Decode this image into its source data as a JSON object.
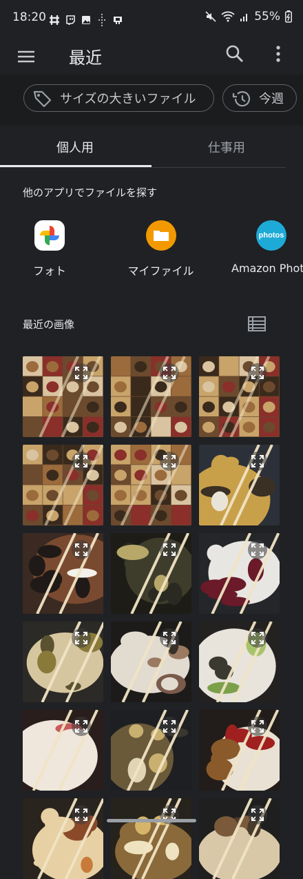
{
  "status_bar": {
    "time": "18:20",
    "battery": "55%"
  },
  "app_bar": {
    "title": "最近",
    "icons": [
      "menu-icon",
      "search-icon",
      "more-vert-icon"
    ]
  },
  "filters": {
    "large_files": "サイズの大きいファイル",
    "this_week": "今週"
  },
  "tabs": {
    "personal": "個人用",
    "work": "仕事用"
  },
  "sections": {
    "other_apps": "他のアプリでファイルを探す",
    "recent_images": "最近の画像"
  },
  "apps": [
    {
      "label": "フォト",
      "icon": "google-photos-icon"
    },
    {
      "label": "マイファイル",
      "icon": "my-files-icon"
    },
    {
      "label": "Amazon Photo",
      "icon": "amazon-photos-icon",
      "badge": "photos"
    }
  ],
  "colors": {
    "background": "#202124",
    "accent_orange": "#f29900",
    "amazon_blue": "#1eaad6"
  },
  "images": [
    "collage",
    "collage",
    "collage",
    "collage",
    "collage",
    "ramen",
    "bento",
    "grill",
    "sashimi",
    "curry",
    "steak",
    "greens",
    "tuna",
    "fried-rice",
    "karaage",
    "pizza",
    "fries",
    "soup"
  ]
}
